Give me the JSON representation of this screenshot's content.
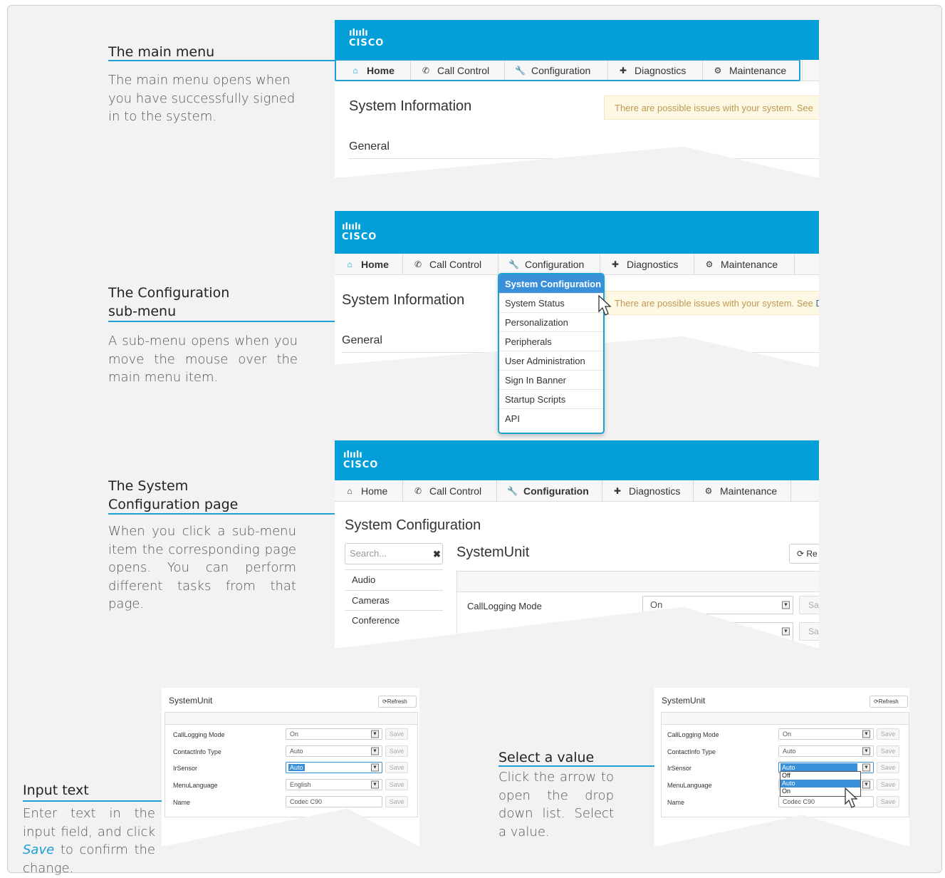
{
  "colors": {
    "accent": "#1ba0d7",
    "cisco_blue": "#049fd9",
    "warning_bg": "#fcf8e3",
    "warning_text": "#c09853"
  },
  "logo": {
    "bars": "ılıılı",
    "word": "CISCO"
  },
  "nav": {
    "home": "Home",
    "call_control": "Call Control",
    "configuration": "Configuration",
    "diagnostics": "Diagnostics",
    "maintenance": "Maintenance"
  },
  "sections": {
    "main_menu": {
      "title": "The main menu",
      "text": "The main menu opens when you have successfully signed in to the system."
    },
    "config_submenu": {
      "title_line1": "The Configuration",
      "title_line2": "sub-menu",
      "text": "A sub-menu opens when you move the mouse over the main menu item."
    },
    "system_config": {
      "title_line1": "The System",
      "title_line2": "Configuration page",
      "text": "When you click a sub-menu item the corresponding page opens. You can perform different tasks from that page."
    },
    "input_text": {
      "title": "Input text",
      "text_before": "Enter text in the input field, and click ",
      "text_em": "Save",
      "text_after": " to confirm the change."
    },
    "select_value": {
      "title": "Select a value",
      "text": "Click the arrow to open the drop down list. Select a value."
    }
  },
  "panel1": {
    "page_title": "System Information",
    "warning": "There are possible issues with your system. See",
    "general": "General"
  },
  "panel2": {
    "page_title": "System Information",
    "warning": "There are possible issues with your system. See ",
    "warning_link": "D",
    "general": "General",
    "submenu": [
      "System Configuration",
      "System Status",
      "Personalization",
      "Peripherals",
      "User Administration",
      "Sign In Banner",
      "Startup Scripts",
      "API"
    ]
  },
  "panel3": {
    "page_title": "System Configuration",
    "search_placeholder": "Search...",
    "section_title": "SystemUnit",
    "refresh": "Re",
    "categories": [
      "Audio",
      "Cameras",
      "Conference"
    ],
    "row_label": "CallLogging Mode",
    "row_value": "On",
    "save": "Sa"
  },
  "panel4": {
    "section_title": "SystemUnit",
    "refresh": "Refresh",
    "rows": [
      {
        "label": "CallLogging Mode",
        "value": "On"
      },
      {
        "label": "ContactInfo Type",
        "value": "Auto"
      },
      {
        "label": "IrSensor",
        "value": "Auto"
      },
      {
        "label": "MenuLanguage",
        "value": "English"
      },
      {
        "label": "Name",
        "value": "Codec C90"
      }
    ],
    "save": "Save"
  },
  "panel5": {
    "section_title": "SystemUnit",
    "refresh": "Refresh",
    "rows": [
      {
        "label": "CallLogging Mode",
        "value": "On"
      },
      {
        "label": "ContactInfo Type",
        "value": "Auto"
      },
      {
        "label": "IrSensor",
        "value": "Auto"
      },
      {
        "label": "MenuLanguage",
        "value": ""
      },
      {
        "label": "Name",
        "value": "Codec C90"
      }
    ],
    "options": [
      "Off",
      "Auto",
      "On"
    ],
    "save": "Save"
  }
}
